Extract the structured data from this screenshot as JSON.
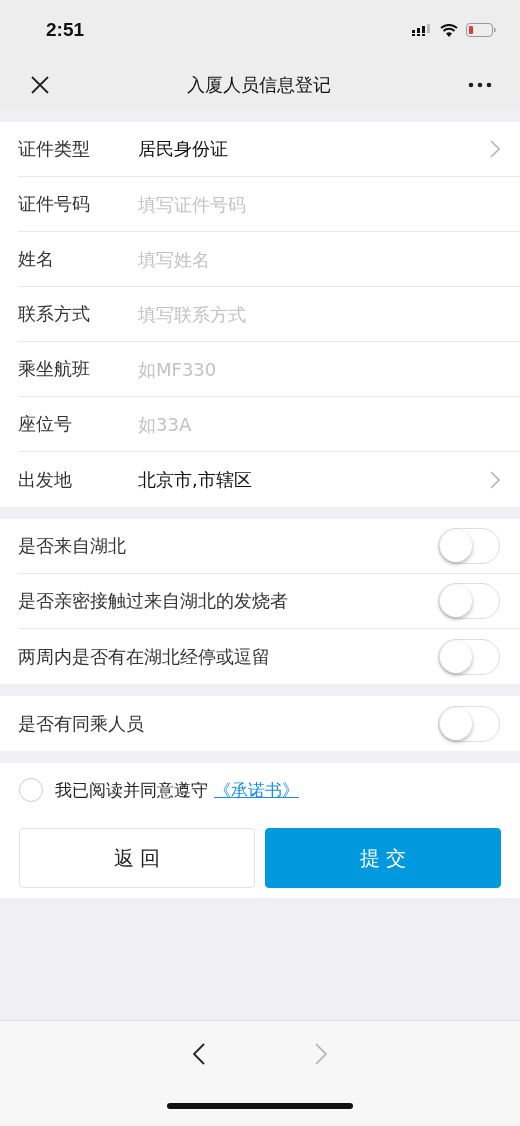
{
  "status_bar": {
    "time": "2:51"
  },
  "nav": {
    "title": "入厦人员信息登记"
  },
  "form": [
    {
      "kind": "select",
      "label": "证件类型",
      "value": "居民身份证"
    },
    {
      "kind": "input",
      "label": "证件号码",
      "placeholder": "填写证件号码"
    },
    {
      "kind": "input",
      "label": "姓名",
      "placeholder": "填写姓名"
    },
    {
      "kind": "input",
      "label": "联系方式",
      "placeholder": "填写联系方式"
    },
    {
      "kind": "input",
      "label": "乘坐航班",
      "placeholder": "如MF330"
    },
    {
      "kind": "input",
      "label": "座位号",
      "placeholder": "如33A"
    },
    {
      "kind": "select",
      "label": "出发地",
      "value": "北京市,市辖区"
    }
  ],
  "toggle_groups": [
    [
      {
        "label": "是否来自湖北",
        "on": false
      },
      {
        "label": "是否亲密接触过来自湖北的发烧者",
        "on": false
      },
      {
        "label": "两周内是否有在湖北经停或逗留",
        "on": false
      }
    ],
    [
      {
        "label": "是否有同乘人员",
        "on": false
      }
    ]
  ],
  "agreement": {
    "checked": false,
    "text": "我已阅读并同意遵守",
    "link": "《承诺书》"
  },
  "buttons": [
    {
      "label": "返 回",
      "kind": "secondary"
    },
    {
      "label": "提 交",
      "kind": "primary"
    }
  ],
  "toolbar": {
    "back_disabled": false,
    "forward_disabled": true
  }
}
